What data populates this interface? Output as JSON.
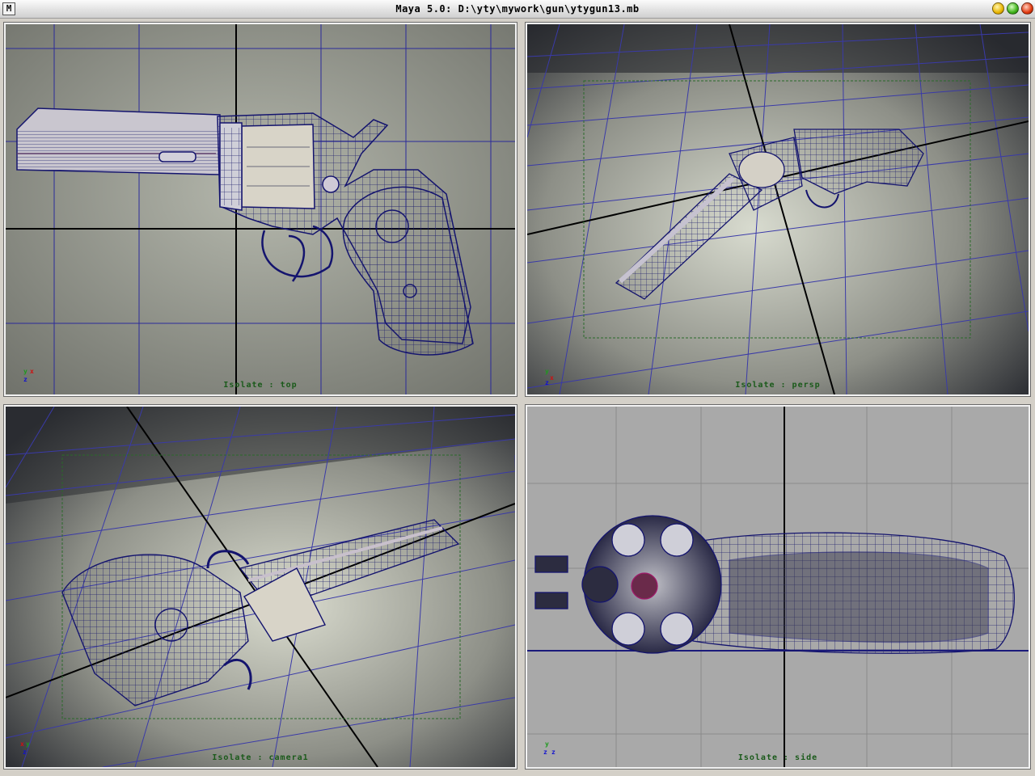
{
  "window": {
    "title": "Maya 5.0: D:\\yty\\mywork\\gun\\ytygun13.mb",
    "app_icon": "M",
    "buttons": [
      "minimize-button",
      "maximize-button",
      "close-button"
    ]
  },
  "viewports": {
    "top": {
      "label": "Isolate : top",
      "axes": {
        "a": "y",
        "b": "x",
        "c": "z"
      }
    },
    "persp": {
      "label": "Isolate : persp",
      "axes": {
        "a": "y",
        "b": "x",
        "c": "z"
      }
    },
    "camera": {
      "label": "Isolate : camera1",
      "axes": {
        "a": "x",
        "b": "y",
        "c": "z"
      }
    },
    "side": {
      "label": "Isolate : side",
      "axes": {
        "a": "y",
        "b": "z",
        "c": "z"
      }
    }
  },
  "colors": {
    "wire": "#1a1a7a",
    "grid_minor": "#2a2a9a",
    "grid_major": "#000000",
    "bg_flat": "#8d8f87",
    "bg_side": "#a8a8a8",
    "label_green": "#1a5a1a",
    "grip_fill": "#b9b9c6",
    "cylinder_fill": "#d8d4c8"
  }
}
